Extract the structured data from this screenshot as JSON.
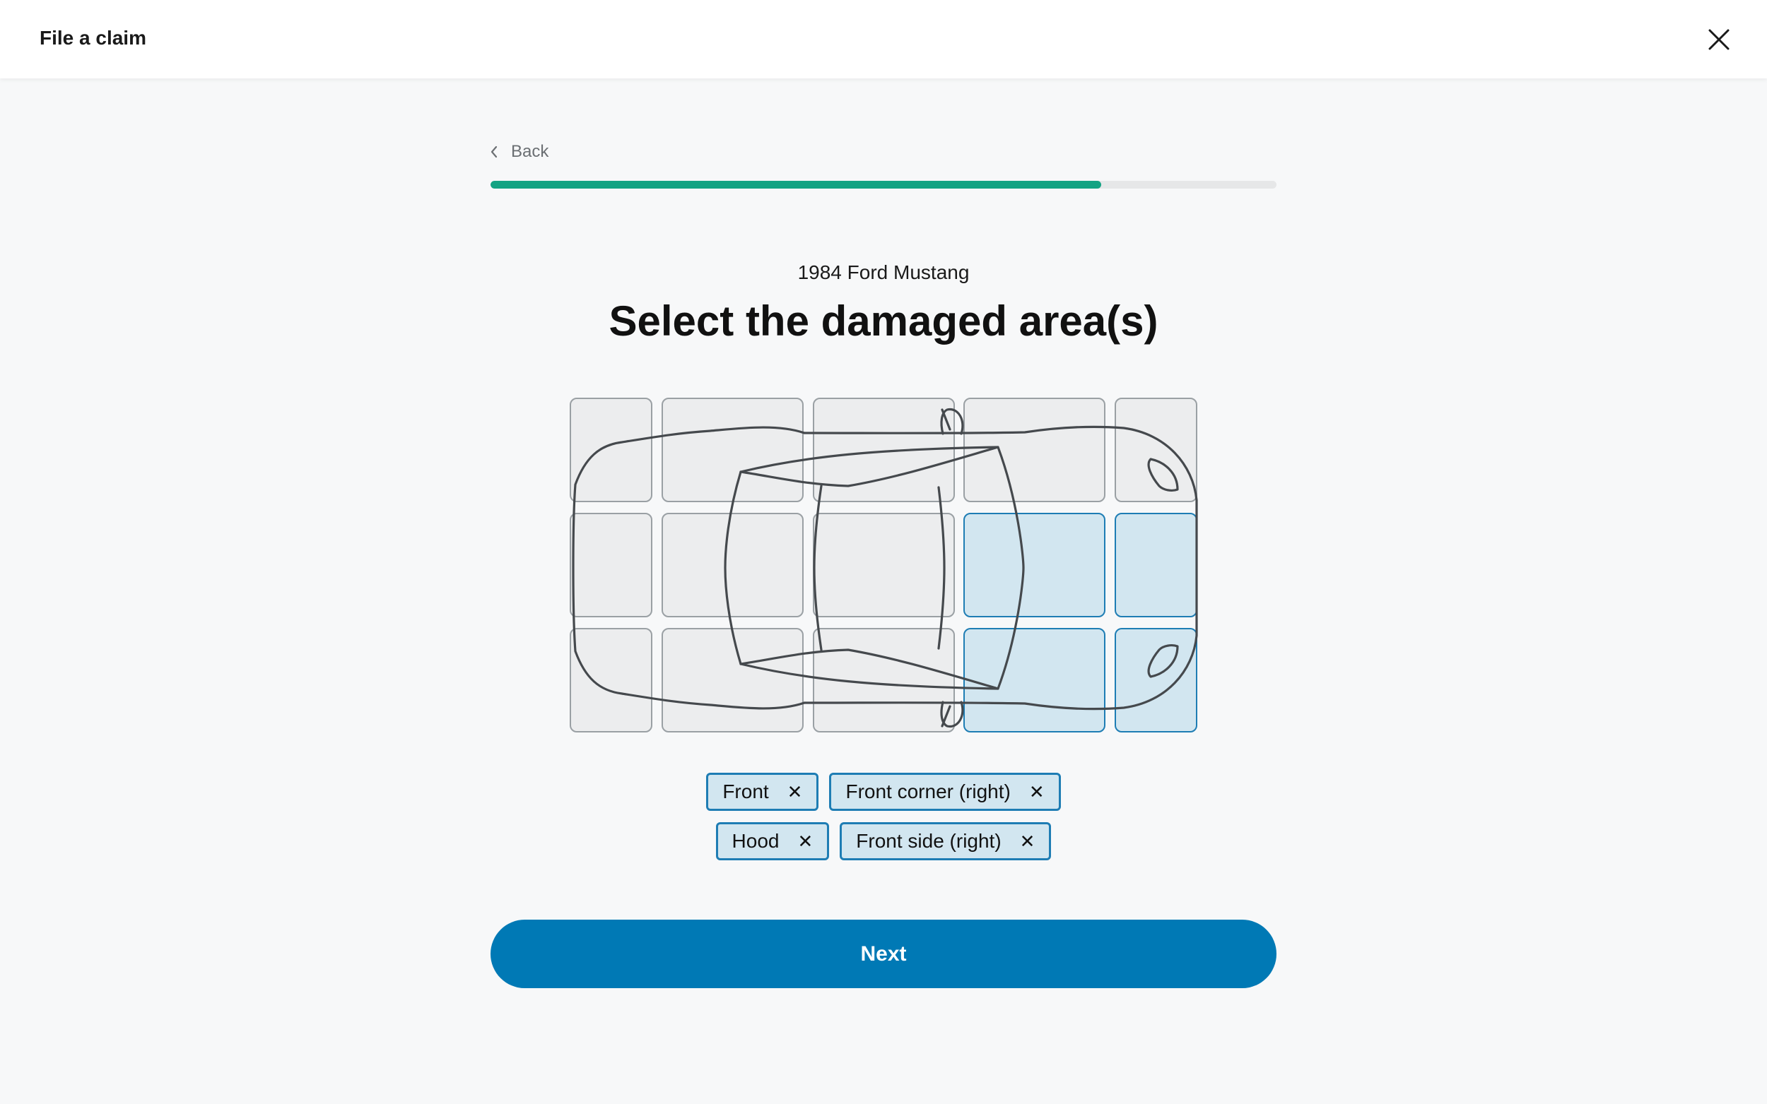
{
  "header": {
    "title": "File a claim",
    "close_icon": "close-icon"
  },
  "nav": {
    "back_label": "Back",
    "back_icon": "chevron-left-icon"
  },
  "progress": {
    "fraction": 0.777,
    "fill_color": "#13a383"
  },
  "vehicle": {
    "name": "1984 Ford Mustang"
  },
  "main": {
    "title": "Select the damaged area(s)"
  },
  "damage_grid": {
    "selected_color": "#d2e6f0",
    "selected_border": "#1e7db4",
    "cells": [
      {
        "id": "r1c1",
        "selected": false
      },
      {
        "id": "r1c2",
        "selected": false
      },
      {
        "id": "r1c3",
        "selected": false
      },
      {
        "id": "r1c4",
        "selected": false
      },
      {
        "id": "r1c5",
        "selected": false
      },
      {
        "id": "r2c1",
        "selected": false
      },
      {
        "id": "r2c2",
        "selected": false
      },
      {
        "id": "r2c3",
        "selected": false
      },
      {
        "id": "r2c4",
        "selected": true
      },
      {
        "id": "r2c5",
        "selected": true
      },
      {
        "id": "r3c1",
        "selected": false
      },
      {
        "id": "r3c2",
        "selected": false
      },
      {
        "id": "r3c3",
        "selected": false
      },
      {
        "id": "r3c4",
        "selected": true
      },
      {
        "id": "r3c5",
        "selected": true
      }
    ]
  },
  "selected_areas": {
    "row1": [
      {
        "label": "Front",
        "remove_icon": "close-icon"
      },
      {
        "label": "Front corner (right)",
        "remove_icon": "close-icon"
      }
    ],
    "row2": [
      {
        "label": "Hood",
        "remove_icon": "close-icon"
      },
      {
        "label": "Front side (right)",
        "remove_icon": "close-icon"
      }
    ]
  },
  "actions": {
    "next_label": "Next",
    "primary_color": "#0079b5"
  }
}
